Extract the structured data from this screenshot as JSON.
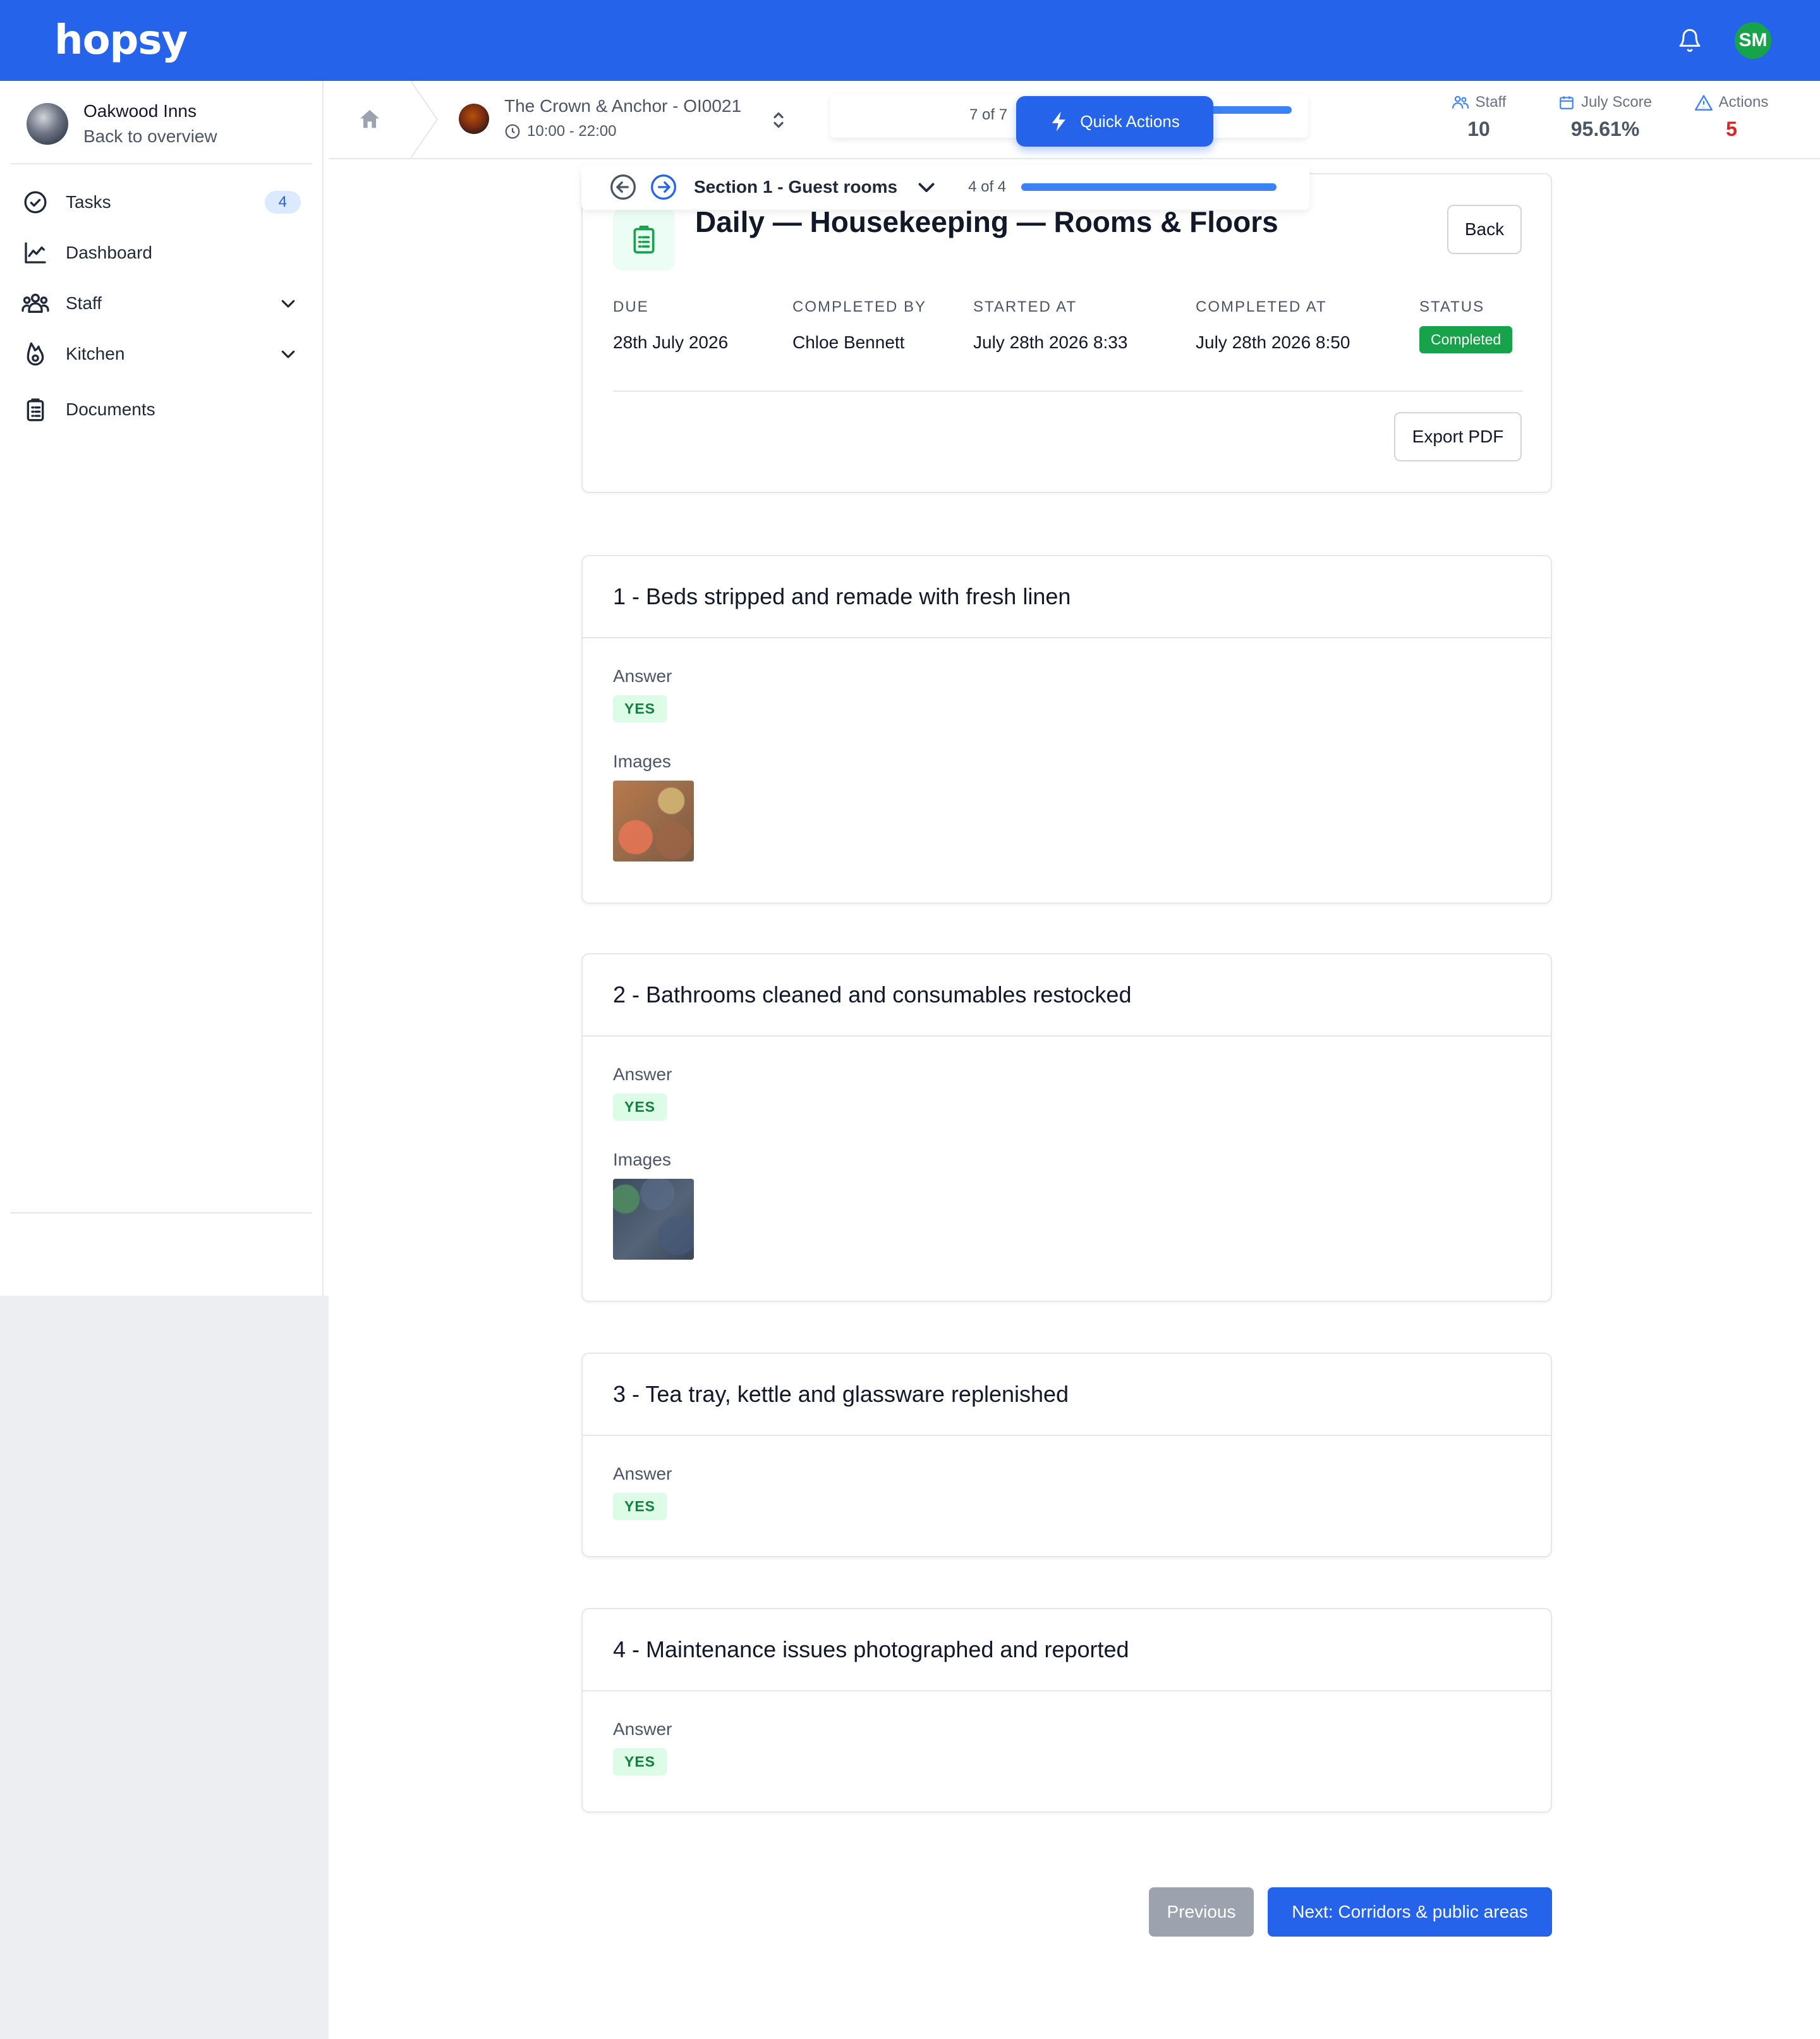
{
  "brand": {
    "logo": "hopsy"
  },
  "topbar": {
    "user_initials": "SM",
    "icons": [
      "bell-icon"
    ]
  },
  "sidebar": {
    "org_name": "Oakwood Inns",
    "org_sub": "Back to overview",
    "items": [
      {
        "label": "Tasks",
        "icon": "check-circle-icon",
        "badge": "4"
      },
      {
        "label": "Dashboard",
        "icon": "chart-line-icon"
      },
      {
        "label": "Staff",
        "icon": "users-icon",
        "expandable": true
      },
      {
        "label": "Kitchen",
        "icon": "flame-icon",
        "expandable": true
      },
      {
        "label": "Documents",
        "icon": "clipboard-icon"
      }
    ]
  },
  "header": {
    "location_title": "The Crown & Anchor - OI0021",
    "location_time": "10:00 - 22:00",
    "progress_text": "7 of 7",
    "quick_actions_label": "Quick Actions",
    "stats": [
      {
        "label": "Staff",
        "value": "10",
        "icon": "users-icon"
      },
      {
        "label": "July Score",
        "value": "95.61%",
        "icon": "calendar-icon"
      },
      {
        "label": "Actions",
        "value": "5",
        "icon": "warning-icon"
      }
    ]
  },
  "section": {
    "title": "Section 1 - Guest rooms",
    "count": "4 of 4"
  },
  "summary": {
    "title": "Daily — Housekeeping — Rooms & Floors",
    "back_label": "Back",
    "export_label": "Export PDF",
    "meta": [
      {
        "key": "DUE",
        "value": "28th July 2026"
      },
      {
        "key": "COMPLETED BY",
        "value": "Chloe Bennett"
      },
      {
        "key": "STARTED AT",
        "value": "July 28th 2026 8:33"
      },
      {
        "key": "COMPLETED AT",
        "value": "July 28th 2026 8:50"
      },
      {
        "key": "STATUS",
        "value": "Completed"
      }
    ],
    "status_color": "#16a34a"
  },
  "questions": [
    {
      "title": "1 - Beds stripped and remade with fresh linen",
      "answer_label": "Answer",
      "answer": "YES",
      "images_label": "Images"
    },
    {
      "title": "2 - Bathrooms cleaned and consumables restocked",
      "answer_label": "Answer",
      "answer": "YES",
      "images_label": "Images"
    },
    {
      "title": "3 - Tea tray, kettle and glassware replenished",
      "answer_label": "Answer",
      "answer": "YES"
    },
    {
      "title": "4 - Maintenance issues photographed and reported",
      "answer_label": "Answer",
      "answer": "YES"
    }
  ],
  "footer": {
    "previous_label": "Previous",
    "next_label": "Next: Corridors & public areas"
  },
  "colors": {
    "primary": "#2563eb",
    "success": "#16a34a",
    "danger": "#dc2626"
  }
}
